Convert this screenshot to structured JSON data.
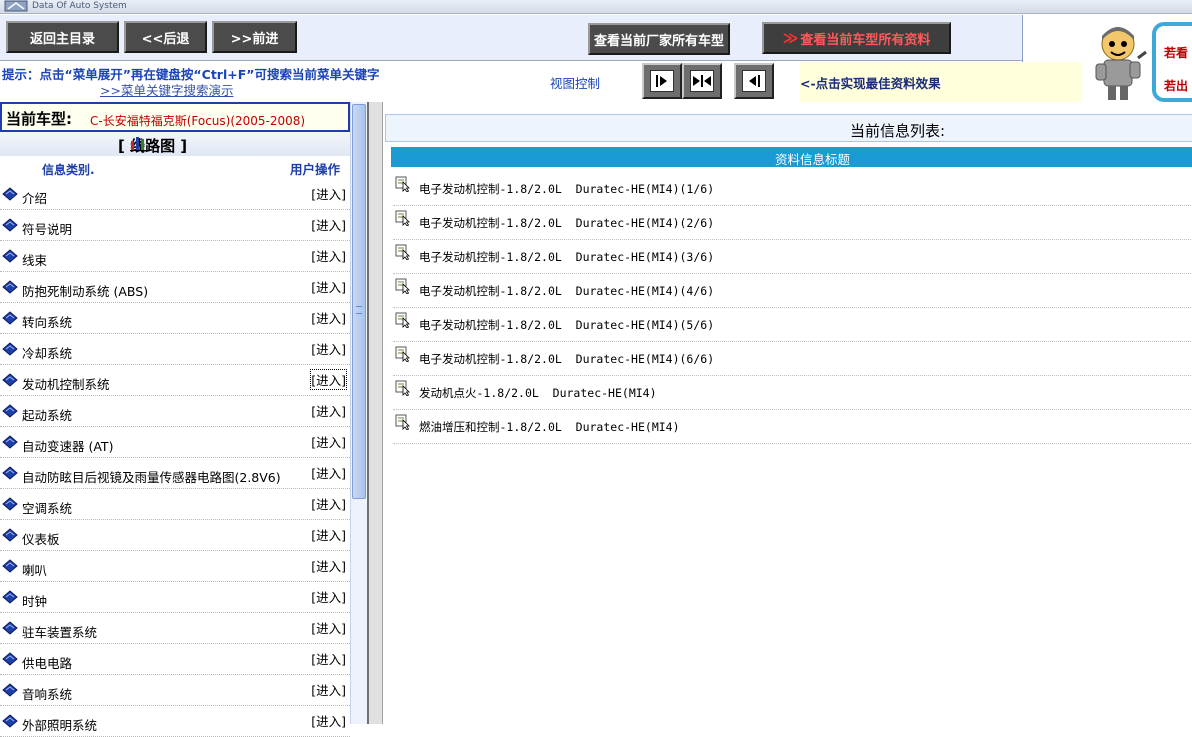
{
  "banner": {
    "logo_text": "Data Of Auto System"
  },
  "toolbar": {
    "home_label": "返回主目录",
    "back_label": "<<后退",
    "forward_label": ">>前进",
    "maker_label": "查看当前厂家所有车型",
    "all_info_arrow": "≫",
    "all_info_label": "查看当前车型所有资料"
  },
  "side_panel": {
    "link1": "若看",
    "link2": "若出"
  },
  "hint": {
    "text": "提示：点击“菜单展开”再在键盘按“Ctrl+F”可搜索当前菜单关键字",
    "demo_link": ">>菜单关键字搜索演示"
  },
  "view_control": {
    "label": "视图控制",
    "effect_text": "<-点击实现最佳资料效果"
  },
  "left": {
    "current_model_label": "当前车型:",
    "current_model_value": "C-长安福特福克斯(Focus)(2005-2008)",
    "diagram_title": "[ 线路图 ]",
    "col_category": "信息类别.",
    "col_action": "用户操作",
    "items": [
      {
        "label": "介绍",
        "action": "[进入]"
      },
      {
        "label": "符号说明",
        "action": "[进入]"
      },
      {
        "label": "线束",
        "action": "[进入]"
      },
      {
        "label": "防抱死制动系统 (ABS)",
        "action": "[进入]"
      },
      {
        "label": "转向系统",
        "action": "[进入]"
      },
      {
        "label": "冷却系统",
        "action": "[进入]"
      },
      {
        "label": "发动机控制系统",
        "action": "[进入]"
      },
      {
        "label": "起动系统",
        "action": "[进入]"
      },
      {
        "label": "自动变速器 (AT)",
        "action": "[进入]"
      },
      {
        "label": "自动防眩目后视镜及雨量传感器电路图(2.8V6)",
        "action": "[进入]"
      },
      {
        "label": "空调系统",
        "action": "[进入]"
      },
      {
        "label": "仪表板",
        "action": "[进入]"
      },
      {
        "label": "喇叭",
        "action": "[进入]"
      },
      {
        "label": "时钟",
        "action": "[进入]"
      },
      {
        "label": "驻车装置系统",
        "action": "[进入]"
      },
      {
        "label": "供电电路",
        "action": "[进入]"
      },
      {
        "label": "音响系统",
        "action": "[进入]"
      },
      {
        "label": "外部照明系统",
        "action": "[进入]"
      }
    ]
  },
  "right": {
    "header": "当前信息列表:",
    "subheader": "资料信息标题",
    "docs": [
      "电子发动机控制-1.8/2.0L  Duratec-HE(MI4)(1/6)",
      "电子发动机控制-1.8/2.0L  Duratec-HE(MI4)(2/6)",
      "电子发动机控制-1.8/2.0L  Duratec-HE(MI4)(3/6)",
      "电子发动机控制-1.8/2.0L  Duratec-HE(MI4)(4/6)",
      "电子发动机控制-1.8/2.0L  Duratec-HE(MI4)(5/6)",
      "电子发动机控制-1.8/2.0L  Duratec-HE(MI4)(6/6)",
      "发动机点火-1.8/2.0L  Duratec-HE(MI4)",
      "燃油增压和控制-1.8/2.0L  Duratec-HE(MI4)"
    ]
  }
}
